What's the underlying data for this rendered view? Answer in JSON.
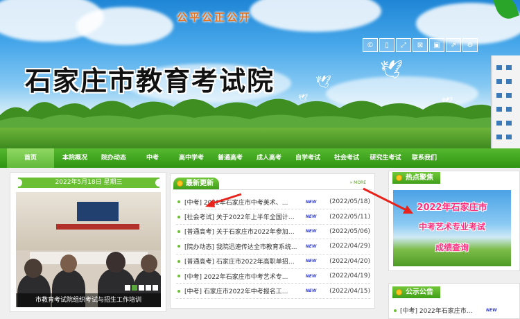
{
  "header": {
    "slogan": "公平公正公开",
    "site_title": "石家庄市教育考试院",
    "tools": [
      {
        "icon": "copyright-icon",
        "glyph": "©"
      },
      {
        "icon": "page-icon",
        "glyph": "▯"
      },
      {
        "icon": "fullscreen-icon",
        "glyph": "⤢"
      },
      {
        "icon": "fit-icon",
        "glyph": "⊠"
      },
      {
        "icon": "save-icon",
        "glyph": "▣"
      },
      {
        "icon": "share-icon",
        "glyph": "⇗"
      },
      {
        "icon": "settings-icon",
        "glyph": "⚙"
      }
    ]
  },
  "nav": {
    "items": [
      "首页",
      "本院概况",
      "院办动态",
      "中考",
      "高中学考",
      "普通高考",
      "成人高考",
      "自学考试",
      "社会考试",
      "研究生考试",
      "联系我们"
    ],
    "active_index": 0
  },
  "date_bar": "2022年5月18日  星期三",
  "slider": {
    "caption": "市教育考试院组织考试与招生工作培训",
    "dot_count": 5,
    "active_dot": 1
  },
  "news": {
    "title": "最新更新",
    "more_label": "» MORE",
    "new_badge": "NEW",
    "items": [
      {
        "text": "[中考] 2022年石家庄市中考美术、...",
        "date": "(2022/05/18)"
      },
      {
        "text": "[社会考试] 关于2022年上半年全国计算...",
        "date": "(2022/05/11)"
      },
      {
        "text": "[普通高考] 关于石家庄市2022年参加全...",
        "date": "(2022/05/06)"
      },
      {
        "text": "[院办动态] 我院迅速传达全市教育系统...",
        "date": "(2022/04/29)"
      },
      {
        "text": "[普通高考] 石家庄市2022年高职单招考...",
        "date": "(2022/04/20)"
      },
      {
        "text": "[中考] 2022年石家庄市中考艺术专...",
        "date": "(2022/04/19)"
      },
      {
        "text": "[中考] 石家庄市2022年中考报名工...",
        "date": "(2022/04/15)"
      }
    ]
  },
  "hot": {
    "title": "热点聚焦",
    "promo_line1": "2022年石家庄市",
    "promo_line2": "中考艺术专业考试",
    "promo_line3": "成绩查询"
  },
  "notice": {
    "title": "公示公告",
    "first_item": "[中考] 2022年石家庄市...",
    "new_badge": "NEW"
  },
  "colors": {
    "nav_green": "#3a9e1b",
    "accent_orange": "#e8731f",
    "promo_pink": "#ff2d7d",
    "arrow_red": "#e8231c"
  }
}
